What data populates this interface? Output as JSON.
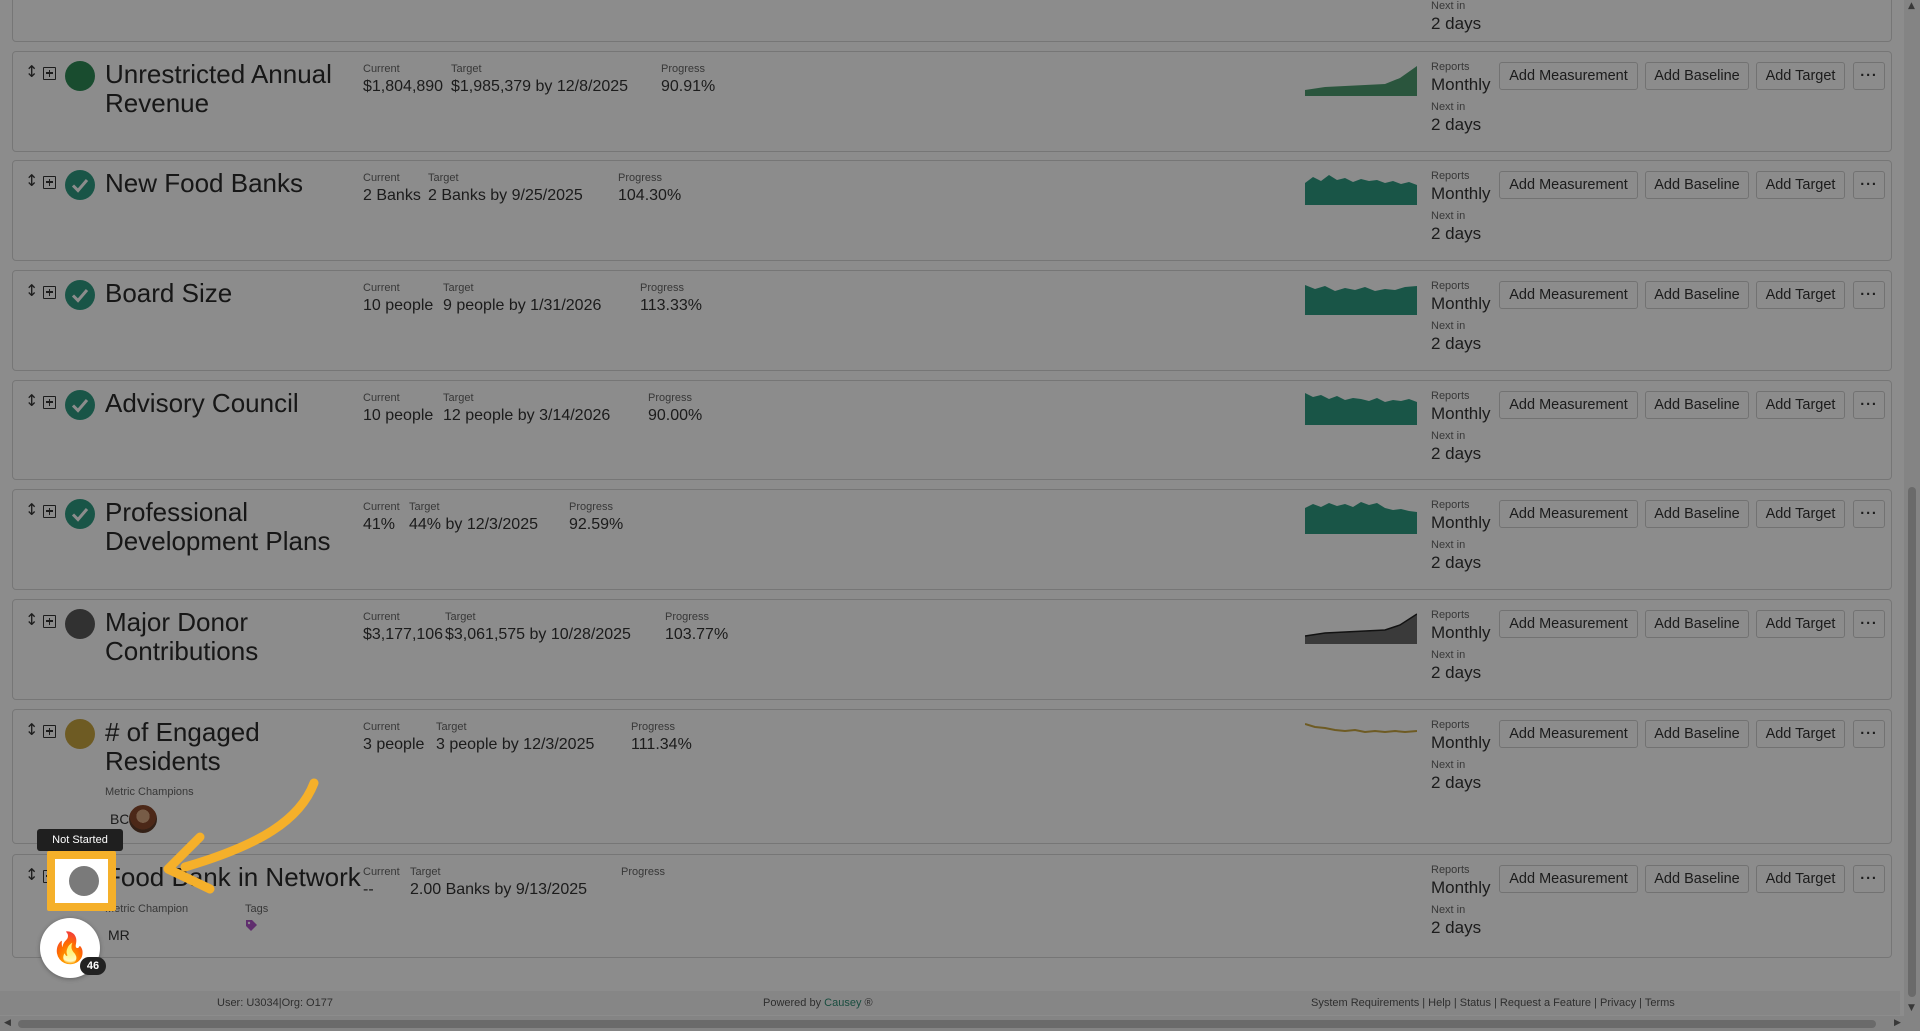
{
  "colors": {
    "accent": "#2f8c74",
    "teal": "#2e9c82",
    "green": "#2e8b57",
    "gray": "#5a5a5a",
    "gold": "#c9a641",
    "highlight": "#f5b02a"
  },
  "top_partial": {
    "next_in_label": "Next in",
    "next_in_value": "2 days"
  },
  "labels": {
    "current": "Current",
    "target": "Target",
    "progress": "Progress",
    "reports": "Reports",
    "next_in": "Next in"
  },
  "buttons": {
    "add_measurement": "Add Measurement",
    "add_baseline": "Add Baseline",
    "add_target": "Add Target",
    "more": "···"
  },
  "metrics": [
    {
      "title": "Unrestricted Annual Revenue",
      "status": "green-dot",
      "current": "$1,804,890",
      "target": "$1,985,379 by 12/8/2025",
      "progress": "90.91%",
      "reports": "Monthly",
      "next_in": "2 days",
      "spark_color": "#2e8b57"
    },
    {
      "title": "New Food Banks",
      "status": "check",
      "current": "2 Banks",
      "target": "2 Banks by 9/25/2025",
      "progress": "104.30%",
      "reports": "Monthly",
      "next_in": "2 days",
      "spark_color": "#2e9c82"
    },
    {
      "title": "Board Size",
      "status": "check",
      "current": "10 people",
      "target": "9 people by 1/31/2026",
      "progress": "113.33%",
      "reports": "Monthly",
      "next_in": "2 days",
      "spark_color": "#2e9c82"
    },
    {
      "title": "Advisory Council",
      "status": "check",
      "current": "10 people",
      "target": "12 people by 3/14/2026",
      "progress": "90.00%",
      "reports": "Monthly",
      "next_in": "2 days",
      "spark_color": "#2e9c82"
    },
    {
      "title": "Professional Development Plans",
      "status": "check",
      "current": "41%",
      "target": "44% by 12/3/2025",
      "progress": "92.59%",
      "reports": "Monthly",
      "next_in": "2 days",
      "spark_color": "#2e9c82"
    },
    {
      "title": "Major Donor Contributions",
      "status": "gray-dot",
      "current": "$3,177,106",
      "target": "$3,061,575 by 10/28/2025",
      "progress": "103.77%",
      "reports": "Monthly",
      "next_in": "2 days",
      "spark_color": "#5a5a5a"
    },
    {
      "title": "# of Engaged Residents",
      "status": "gold-dot",
      "current": "3 people",
      "target": "3 people by 12/3/2025",
      "progress": "111.34%",
      "reports": "Monthly",
      "next_in": "2 days",
      "spark_color": "#c9a641",
      "champions_label": "Metric Champions",
      "champion_initials": "BC"
    },
    {
      "title": "Food Bank in Network",
      "status": "not-started",
      "current": "--",
      "target": "2.00 Banks by 9/13/2025",
      "progress": "",
      "reports": "Monthly",
      "next_in": "2 days",
      "champions_label": "Metric Champion",
      "champion_initials": "MR",
      "tags_label": "Tags"
    }
  ],
  "tooltip": "Not Started",
  "fab_badge": "46",
  "footer": {
    "user": "User: U3034|Org: O177",
    "powered_by": "Powered by",
    "brand": "Causey",
    "brand_mark": "®",
    "links": "System Requirements | Help | Status | Request a Feature | Privacy | Terms"
  }
}
